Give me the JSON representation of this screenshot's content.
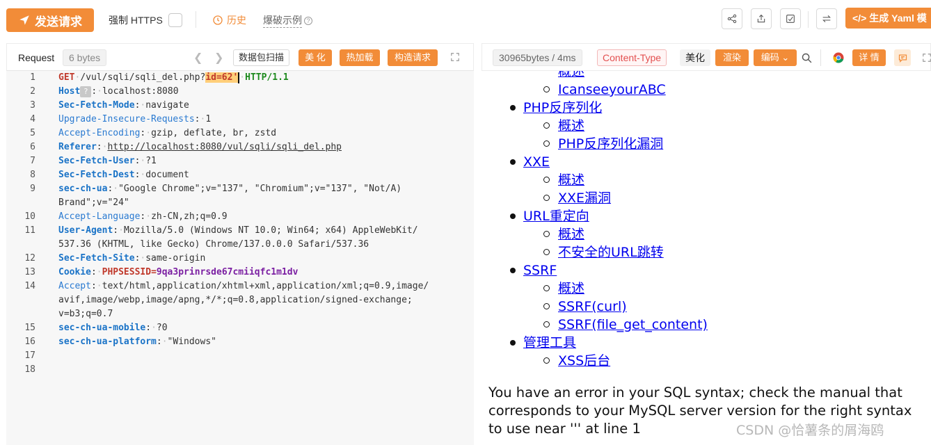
{
  "toolbar": {
    "send_label": "发送请求",
    "force_https_label": "强制 HTTPS",
    "history_label": "历史",
    "explode_label": "爆破示例",
    "yaml_label": "生成 Yaml 模"
  },
  "request": {
    "label": "Request",
    "bytes": "6 bytes",
    "scan_label": "数据包扫描",
    "beautify_label": "美 化",
    "hotload_label": "热加载",
    "build_label": "构造请求"
  },
  "code": {
    "l1_method": "GET",
    "l1_path": "/vul/sqli/sqli_del.php?",
    "l1_param": "id=62'",
    "l1_proto": "HTTP/1.1",
    "l2_key": "Host",
    "l2_val": "localhost:8080",
    "l3_key": "Sec-Fetch-Mode",
    "l3_val": "navigate",
    "l4_key": "Upgrade-Insecure-Requests",
    "l4_val": "1",
    "l5_key": "Accept-Encoding",
    "l5_val": "gzip, deflate, br, zstd",
    "l6_key": "Referer",
    "l6_val": "http://localhost:8080/vul/sqli/sqli_del.php",
    "l7_key": "Sec-Fetch-User",
    "l7_val": "?1",
    "l8_key": "Sec-Fetch-Dest",
    "l8_val": "document",
    "l9_key": "sec-ch-ua",
    "l9_val": "\"Google Chrome\";v=\"137\", \"Chromium\";v=\"137\", \"Not/A)",
    "l9_val2": "Brand\";v=\"24\"",
    "l10_key": "Accept-Language",
    "l10_val": "zh-CN,zh;q=0.9",
    "l11_key": "User-Agent",
    "l11_val": "Mozilla/5.0 (Windows NT 10.0; Win64; x64) AppleWebKit/",
    "l11_val2": "537.36 (KHTML, like Gecko) Chrome/137.0.0.0 Safari/537.36",
    "l12_key": "Sec-Fetch-Site",
    "l12_val": "same-origin",
    "l13_key": "Cookie",
    "l13_ck": "PHPSESSID",
    "l13_cv": "9qa3prinrsde67cmiiqfc1m1dv",
    "l14_key": "Accept",
    "l14_val": "text/html,application/xhtml+xml,application/xml;q=0.9,image/",
    "l14_val2": "avif,image/webp,image/apng,*/*;q=0.8,application/signed-exchange;",
    "l14_val3": "v=b3;q=0.7",
    "l15_key": "sec-ch-ua-mobile",
    "l15_val": "?0",
    "l16_key": "sec-ch-ua-platform",
    "l16_val": "\"Windows\"",
    "line_numbers": [
      "1",
      "2",
      "3",
      "4",
      "5",
      "6",
      "7",
      "8",
      "9",
      "10",
      "11",
      "12",
      "13",
      "14",
      "15",
      "16",
      "17",
      "18"
    ]
  },
  "response": {
    "size": "30965bytes / 4ms",
    "content_type": "Content-Type",
    "beautify_label": "美化",
    "render_label": "渲染",
    "encoding_label": "编码",
    "details_label": "详 情"
  },
  "page": {
    "a0": "概述",
    "a1": "IcanseeyourABC",
    "b": "PHP反序列化",
    "b1": "概述",
    "b2": "PHP反序列化漏洞",
    "c": "XXE",
    "c1": "概述",
    "c2": "XXE漏洞",
    "d": "URL重定向",
    "d1": "概述",
    "d2": "不安全的URL跳转",
    "e": "SSRF",
    "e1": "概述",
    "e2": "SSRF(curl)",
    "e3": "SSRF(file_get_content)",
    "f": "管理工具",
    "f1": "XSS后台",
    "error": "You have an error in your SQL syntax; check the manual that corresponds to your MySQL server version for the right syntax to use near ''' at line 1"
  },
  "watermark": "CSDN @恰薯条的屑海鸥"
}
